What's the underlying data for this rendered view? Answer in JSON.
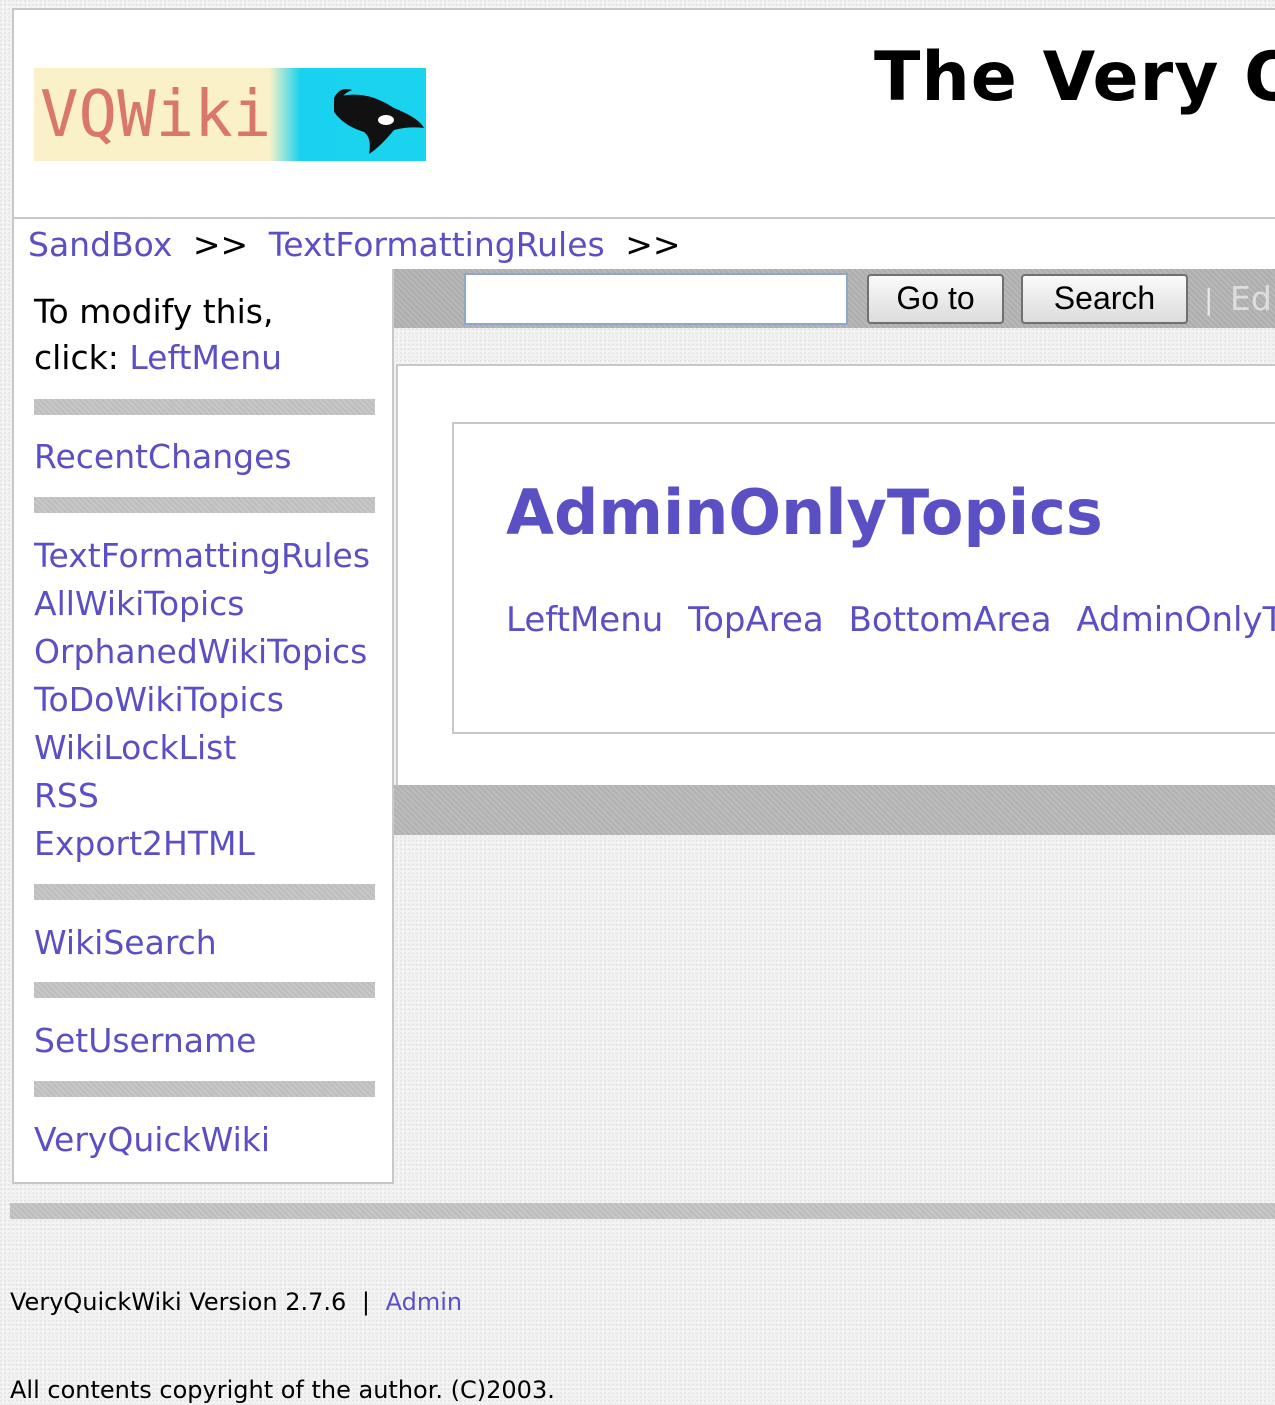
{
  "header": {
    "logo_text": "VQWiki",
    "site_title": "The Very Q"
  },
  "breadcrumb": {
    "items": [
      "SandBox",
      "TextFormattingRules"
    ],
    "separator": ">>"
  },
  "leftmenu": {
    "intro_text": "To modify this,",
    "intro_click": "click:",
    "intro_link": "LeftMenu",
    "items": [
      "RecentChanges",
      "TextFormattingRules",
      "AllWikiTopics",
      "OrphanedWikiTopics",
      "ToDoWikiTopics",
      "WikiLockList",
      "RSS",
      "Export2HTML",
      "WikiSearch",
      "SetUsername",
      "VeryQuickWiki"
    ]
  },
  "toolbar": {
    "search_value": "",
    "goto_label": "Go to",
    "search_label": "Search",
    "separator": "|",
    "edit_label": "Ed"
  },
  "content": {
    "topic_title": "AdminOnlyTopics",
    "links": [
      "LeftMenu",
      "TopArea",
      "BottomArea",
      "AdminOnlyTopi"
    ]
  },
  "footer": {
    "version": "VeryQuickWiki Version 2.7.6",
    "pipe": "|",
    "admin_link": "Admin",
    "copyright": "All contents copyright of the author. (C)2003."
  },
  "colors": {
    "link": "#5b4fc4",
    "logo_text": "#d9776a",
    "logo_bg": "#fbf1c8",
    "logo_water": "#19d2ef"
  },
  "icons": {
    "logo_orca": "orca-whale-icon"
  }
}
